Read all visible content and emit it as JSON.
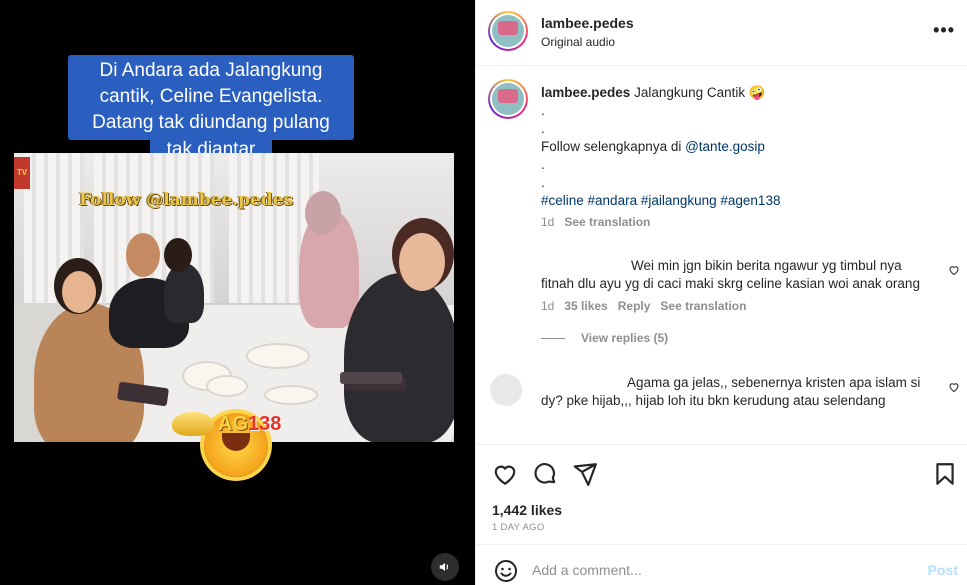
{
  "video": {
    "caption_lines": [
      "Di Andara ada Jalangkung cantik, Celine Evangelista. Datang tak diundang pulang",
      "tak diantar"
    ],
    "watermark": "Follow @lambee.pedes",
    "promo_prefix": "AG",
    "promo_number": "138"
  },
  "header": {
    "username": "lambee.pedes",
    "audio": "Original audio"
  },
  "caption": {
    "username": "lambee.pedes",
    "text": "Jalangkung Cantik 🤪",
    "dots1": ".",
    "dots2": ".",
    "follow_prefix": "Follow selengkapnya di ",
    "follow_mention": "@tante.gosip",
    "dots3": ".",
    "dots4": ".",
    "hashtags": "#celine #andara #jailangkung #agen138",
    "time": "1d",
    "see_translation": "See translation"
  },
  "comments": [
    {
      "text": "Wei min jgn bikin berita ngawur yg timbul nya fitnah dlu ayu yg di caci maki skrg celine kasian woi anak orang",
      "time": "1d",
      "likes": "35 likes",
      "reply": "Reply",
      "see_translation": "See translation",
      "view_replies": "View replies (5)"
    },
    {
      "text": "Agama ga jelas,, sebenernya kristen apa islam si dy? pke hijab,,, hijab loh itu bkn kerudung atau selendang"
    }
  ],
  "footer": {
    "likes": "1,442 likes",
    "date": "1 DAY AGO",
    "comment_placeholder": "Add a comment...",
    "post_label": "Post"
  },
  "colors": {
    "caption_bg": "#2a5fc0",
    "link": "#00376b",
    "muted": "#8e8e8e",
    "post_disabled": "#b2dffc"
  }
}
